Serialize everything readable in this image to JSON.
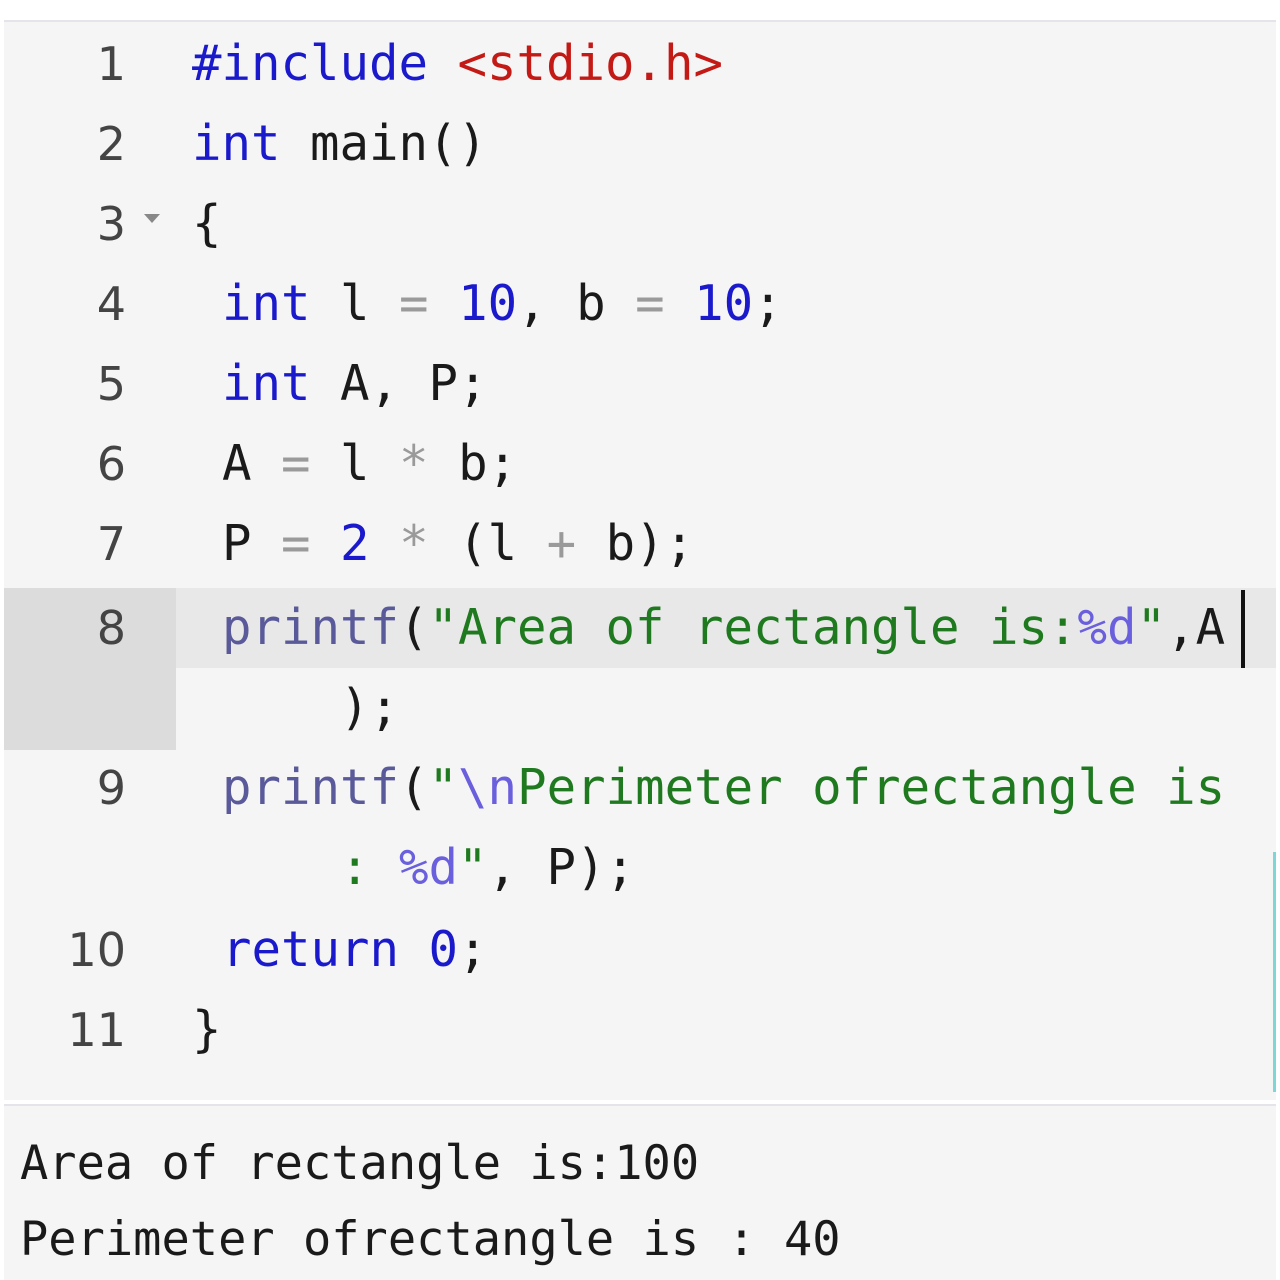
{
  "editor": {
    "fold_icon": "fold-caret-down-icon",
    "lines": [
      {
        "n": "1",
        "tokens": [
          [
            "inc0",
            "#include "
          ],
          [
            "inc",
            "<stdio.h>"
          ]
        ]
      },
      {
        "n": "2",
        "tokens": [
          [
            "kw",
            "int"
          ],
          [
            "pl",
            " main()"
          ]
        ]
      },
      {
        "n": "3",
        "tokens": [
          [
            "pl",
            "{"
          ]
        ]
      },
      {
        "n": "4",
        "tokens": [
          [
            "kw",
            "int"
          ],
          [
            "pl",
            " l "
          ],
          [
            "op",
            "="
          ],
          [
            "pl",
            " "
          ],
          [
            "num",
            "10"
          ],
          [
            "pl",
            ", b "
          ],
          [
            "op",
            "="
          ],
          [
            "pl",
            " "
          ],
          [
            "num",
            "10"
          ],
          [
            "pl",
            ";"
          ]
        ]
      },
      {
        "n": "5",
        "tokens": [
          [
            "kw",
            "int"
          ],
          [
            "pl",
            " A, P;"
          ]
        ]
      },
      {
        "n": "6",
        "tokens": [
          [
            "pl",
            "A "
          ],
          [
            "op",
            "="
          ],
          [
            "pl",
            " l "
          ],
          [
            "op",
            "*"
          ],
          [
            "pl",
            " b;"
          ]
        ]
      },
      {
        "n": "7",
        "tokens": [
          [
            "pl",
            "P "
          ],
          [
            "op",
            "="
          ],
          [
            "pl",
            " "
          ],
          [
            "num",
            "2"
          ],
          [
            "pl",
            " "
          ],
          [
            "op",
            "*"
          ],
          [
            "pl",
            " (l "
          ],
          [
            "op",
            "+"
          ],
          [
            "pl",
            " b);"
          ]
        ]
      },
      {
        "n": "8",
        "tokens": [
          [
            "fn",
            "printf"
          ],
          [
            "pl",
            "("
          ],
          [
            "str",
            "\"Area of rectangle is:"
          ],
          [
            "fmt",
            "%d"
          ],
          [
            "str",
            "\""
          ],
          [
            "pl",
            ",A"
          ]
        ]
      },
      {
        "n": "",
        "tokens": [
          [
            "pl",
            "    );"
          ]
        ]
      },
      {
        "n": "9",
        "tokens": [
          [
            "fn",
            "printf"
          ],
          [
            "pl",
            "("
          ],
          [
            "str",
            "\""
          ],
          [
            "fmt",
            "\\n"
          ],
          [
            "str",
            "Perimeter ofrectangle is"
          ]
        ]
      },
      {
        "n": "",
        "tokens": [
          [
            "str",
            "    : "
          ],
          [
            "fmt",
            "%d"
          ],
          [
            "str",
            "\""
          ],
          [
            "pl",
            ", P);"
          ]
        ]
      },
      {
        "n": "10",
        "tokens": [
          [
            "kw",
            "return"
          ],
          [
            "pl",
            " "
          ],
          [
            "num",
            "0"
          ],
          [
            "pl",
            ";"
          ]
        ]
      },
      {
        "n": "11",
        "tokens": [
          [
            "pl",
            "}"
          ]
        ]
      }
    ]
  },
  "output": {
    "lines": [
      "Area of rectangle is:100",
      "Perimeter ofrectangle is : 40"
    ]
  },
  "colors": {
    "keyword": "#1a1acc",
    "string": "#1f7a1f",
    "include": "#c41a16",
    "format": "#6a5fdc",
    "operator": "#9a9a9a"
  }
}
